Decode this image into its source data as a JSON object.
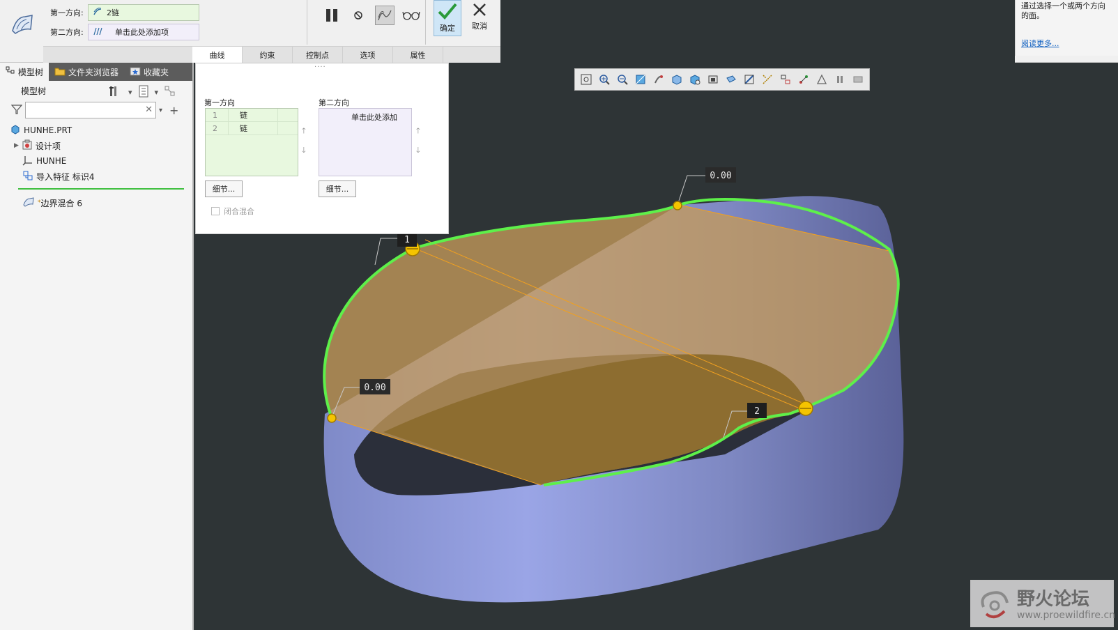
{
  "dashboard": {
    "first_direction_label": "第一方向:",
    "first_direction_value": "2链",
    "second_direction_label": "第二方向:",
    "second_direction_value": "单击此处添加项",
    "ok_label": "确定",
    "cancel_label": "取消",
    "tabs": [
      "曲线",
      "约束",
      "控制点",
      "选项",
      "属性"
    ],
    "active_tab": "曲线"
  },
  "help": {
    "text": "通过选择一个或两个方向的面。",
    "link": "阅读更多..."
  },
  "navigator": {
    "tabs": [
      {
        "label": "模型树",
        "icon": "model-tree-icon"
      },
      {
        "label": "文件夹浏览器",
        "icon": "folder-icon"
      },
      {
        "label": "收藏夹",
        "icon": "favorites-icon"
      }
    ],
    "header": "模型树",
    "search_placeholder": "",
    "items": [
      {
        "label": "HUNHE.PRT",
        "icon": "part-icon"
      },
      {
        "label": "设计项",
        "icon": "design-items-icon"
      },
      {
        "label": "HUNHE",
        "icon": "coordinate-system-icon"
      },
      {
        "label": "导入特征 标识4",
        "icon": "import-feature-icon"
      },
      {
        "label": "边界混合 6",
        "icon": "boundary-blend-icon"
      }
    ]
  },
  "collector": {
    "first_title": "第一方向",
    "second_title": "第二方向",
    "first_rows": [
      {
        "num": "1",
        "value": "链"
      },
      {
        "num": "2",
        "value": "链"
      }
    ],
    "second_placeholder": "单击此处添加",
    "detail_label": "细节...",
    "closed_blend_label": "闭合混合"
  },
  "graphics": {
    "dim_top": "0.00",
    "dim_left": "0.00",
    "label_1": "1",
    "label_2": "2"
  },
  "watermark": {
    "title": "野火论坛",
    "url": "www.proewildfire.cn"
  },
  "colors": {
    "background": "#2e3436",
    "surface_blue": "#8a96d8",
    "preview_orange": "#b08850",
    "chain_green": "#5ef04a",
    "handle_yellow": "#f5c400",
    "ok_blue": "#cfe6f7"
  }
}
